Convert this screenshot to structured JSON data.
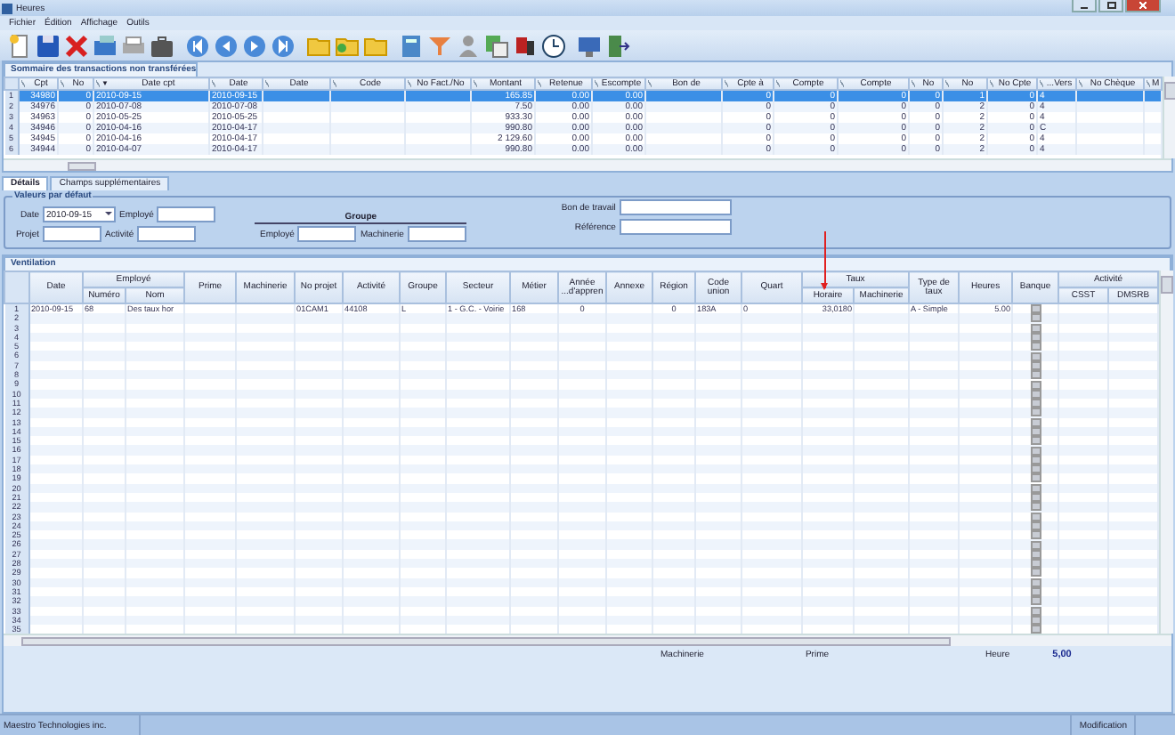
{
  "window": {
    "title": "Heures"
  },
  "menu": [
    "Fichier",
    "Édition",
    "Affichage",
    "Outils"
  ],
  "summary": {
    "title": "Sommaire des transactions non transférées",
    "columns": [
      {
        "label": "Cpt"
      },
      {
        "label": "No"
      },
      {
        "label": "Date cpt",
        "sort_mark": "▼"
      },
      {
        "label": "Date"
      },
      {
        "label": "Date"
      },
      {
        "label": "Code"
      },
      {
        "label": "No Fact./No"
      },
      {
        "label": "Montant"
      },
      {
        "label": "Retenue"
      },
      {
        "label": "Escompte"
      },
      {
        "label": "Bon de"
      },
      {
        "label": "Cpte à"
      },
      {
        "label": "Compte"
      },
      {
        "label": "Compte"
      },
      {
        "label": "No"
      },
      {
        "label": "No"
      },
      {
        "label": "No Cpte"
      },
      {
        "label": "...Vers"
      },
      {
        "label": "No Chèque"
      },
      {
        "label": "M"
      }
    ],
    "rows": [
      {
        "number": "1",
        "selected": true,
        "cells": [
          "34980",
          "0",
          "2010-09-15",
          "2010-09-15",
          null,
          null,
          null,
          "165.85",
          "0.00",
          "0.00",
          null,
          "0",
          "0",
          "0",
          "0",
          "1",
          "0",
          "4",
          null,
          null
        ]
      },
      {
        "number": "2",
        "selected": false,
        "cells": [
          "34976",
          "0",
          "2010-07-08",
          "2010-07-08",
          null,
          null,
          null,
          "7.50",
          "0.00",
          "0.00",
          null,
          "0",
          "0",
          "0",
          "0",
          "2",
          "0",
          "4",
          null,
          null
        ]
      },
      {
        "number": "3",
        "selected": false,
        "cells": [
          "34963",
          "0",
          "2010-05-25",
          "2010-05-25",
          null,
          null,
          null,
          "933.30",
          "0.00",
          "0.00",
          null,
          "0",
          "0",
          "0",
          "0",
          "2",
          "0",
          "4",
          null,
          null
        ]
      },
      {
        "number": "4",
        "selected": false,
        "cells": [
          "34946",
          "0",
          "2010-04-16",
          "2010-04-17",
          null,
          null,
          null,
          "990.80",
          "0.00",
          "0.00",
          null,
          "0",
          "0",
          "0",
          "0",
          "2",
          "0",
          "C",
          null,
          null
        ]
      },
      {
        "number": "5",
        "selected": false,
        "cells": [
          "34945",
          "0",
          "2010-04-16",
          "2010-04-17",
          null,
          null,
          null,
          "2 129.60",
          "0.00",
          "0.00",
          null,
          "0",
          "0",
          "0",
          "0",
          "2",
          "0",
          "4",
          null,
          null
        ]
      },
      {
        "number": "6",
        "selected": false,
        "cells": [
          "34944",
          "0",
          "2010-04-07",
          "2010-04-17",
          null,
          null,
          null,
          "990.80",
          "0.00",
          "0.00",
          null,
          "0",
          "0",
          "0",
          "0",
          "2",
          "0",
          "4",
          null,
          null
        ]
      }
    ]
  },
  "details_tabs": [
    {
      "label": "Détails",
      "selected": true
    },
    {
      "label": "Champs supplémentaires",
      "selected": false
    }
  ],
  "defaults": {
    "title": "Valeurs par défaut",
    "date": {
      "label": "Date",
      "value": "2010-09-15"
    },
    "employee_label": "Employé",
    "project_label": "Projet",
    "activity_label": "Activité",
    "group": {
      "title": "Groupe",
      "employee_label": "Employé",
      "machinery_label": "Machinerie"
    },
    "work_order_label": "Bon de travail",
    "reference_label": "Référence"
  },
  "ventilation": {
    "tab": "Ventilation",
    "columns": [
      {
        "label": "Date"
      },
      {
        "label": "Employé",
        "children": [
          "Numéro",
          "Nom"
        ]
      },
      {
        "label": "Prime"
      },
      {
        "label": "Machinerie"
      },
      {
        "label": "No projet"
      },
      {
        "label": "Activité"
      },
      {
        "label": "Groupe"
      },
      {
        "label": "Secteur"
      },
      {
        "label": "Métier"
      },
      {
        "label": "Année ...d'appren"
      },
      {
        "label": "Annexe"
      },
      {
        "label": "Région"
      },
      {
        "label": "Code union"
      },
      {
        "label": "Quart"
      },
      {
        "label": "Taux",
        "children": [
          "Horaire",
          "Machinerie"
        ]
      },
      {
        "label": "Type de taux"
      },
      {
        "label": "Heures"
      },
      {
        "label": "Banque"
      },
      {
        "label": "Activité",
        "children": [
          "CSST",
          "DMSRB"
        ]
      }
    ],
    "rows": [
      {
        "number": "1",
        "cells": [
          "2010-09-15",
          "68",
          "Des taux hor",
          null,
          null,
          "01CAM1",
          "44108",
          "L",
          "1 - G.C. - Voirie",
          "168",
          "0",
          null,
          "0",
          "183A",
          "0",
          "33,0180",
          null,
          "A - Simple",
          "5.00",
          null,
          null,
          null
        ]
      },
      {
        "number": "2"
      },
      {
        "number": "3"
      },
      {
        "number": "4"
      },
      {
        "number": "5"
      },
      {
        "number": "6"
      },
      {
        "number": "7"
      },
      {
        "number": "8"
      },
      {
        "number": "9"
      },
      {
        "number": "10"
      },
      {
        "number": "11"
      },
      {
        "number": "12"
      },
      {
        "number": "13"
      },
      {
        "number": "14"
      },
      {
        "number": "15"
      },
      {
        "number": "16"
      },
      {
        "number": "17"
      },
      {
        "number": "18"
      },
      {
        "number": "19"
      },
      {
        "number": "20"
      },
      {
        "number": "21"
      },
      {
        "number": "22"
      },
      {
        "number": "23"
      },
      {
        "number": "24"
      },
      {
        "number": "25"
      },
      {
        "number": "26"
      },
      {
        "number": "27"
      },
      {
        "number": "28"
      },
      {
        "number": "29"
      },
      {
        "number": "30"
      },
      {
        "number": "31"
      },
      {
        "number": "32"
      },
      {
        "number": "33"
      },
      {
        "number": "34"
      },
      {
        "number": "35"
      }
    ]
  },
  "totals": [
    {
      "label": "Machinerie"
    },
    {
      "label": "Prime"
    },
    {
      "label": "Heure",
      "value": "5,00"
    }
  ],
  "status_bar": [
    "Maestro Technologies inc.",
    "Modification"
  ]
}
